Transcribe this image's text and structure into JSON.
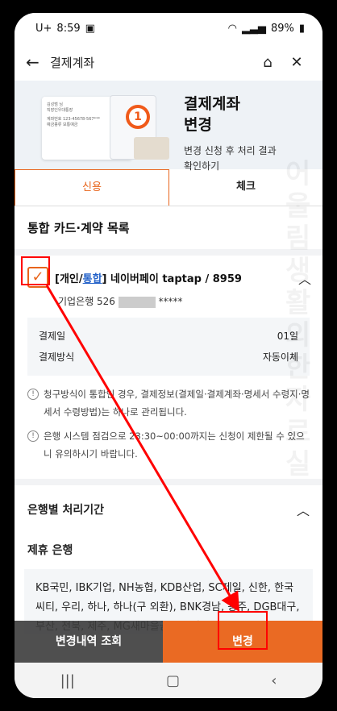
{
  "status": {
    "carrier": "U+",
    "time": "8:59",
    "battery": "89%"
  },
  "appbar": {
    "title": "결제계좌",
    "back_label": "←",
    "home_label": "⌂",
    "close_label": "✕"
  },
  "hero": {
    "title_line1": "결제계좌",
    "title_line2": "변경",
    "sub_line1": "변경 신청 후 처리 결과",
    "sub_line2": "확인하기",
    "card_text1": "김성범 님",
    "card_text2": "직장인우대통장",
    "card_text3": "계좌번호 123-45678-567***",
    "card_text4": "예금종류 보통예금"
  },
  "tabs": {
    "credit": "신용",
    "check": "체크"
  },
  "list_title": "통합 카드·계약 목록",
  "card": {
    "prefix": "개인/",
    "link": "통합",
    "suffix": "] 네이버페이 taptap / 8959",
    "bracket_open": "[",
    "account_bank": "기업은행 526",
    "account_tail": "*****",
    "detail": [
      {
        "label": "결제일",
        "value": "01일"
      },
      {
        "label": "결제방식",
        "value": "자동이체"
      }
    ]
  },
  "notices": [
    "청구방식이 통합인 경우, 결제정보(결제일·결제계좌·명세서 수령지·명세서 수령방법)는 하나로 관리됩니다.",
    "은행 시스템 점검으로 23:30~00:00까지는 신청이 제한될 수 있으니 유의하시기 바랍니다."
  ],
  "bank_section": {
    "title": "은행별 처리기간",
    "partner_title": "제휴 은행",
    "banks": "KB국민, IBK기업, NH농협, KDB산업, SC제일, 신한, 한국씨티, 우리, 하나, 하나(구 외환), BNK경남, 광주, DGB대구, 부산, 전북, 제주, MG새마을금고, 신협, 우체국, 삼성증권, 유안타증권, 카카오뱅크,"
  },
  "bottom": {
    "history": "변경내역 조회",
    "change": "변경"
  },
  "watermark": "어울림생활의한자료실",
  "colors": {
    "accent": "#e8641b",
    "link": "#2563c9",
    "annotation": "#ff0000"
  },
  "icons": [
    "back-arrow-icon",
    "home-icon",
    "close-icon",
    "checkbox-checked-icon",
    "chevron-up-icon",
    "info-icon"
  ]
}
